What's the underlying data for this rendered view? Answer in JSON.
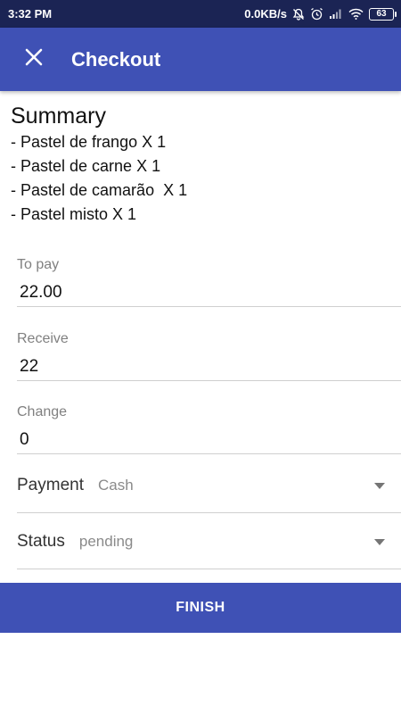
{
  "status_bar": {
    "time": "3:32 PM",
    "network_speed": "0.0KB/s",
    "battery_level": "63",
    "icons": [
      "mute-notification-icon",
      "alarm-icon",
      "signal-icon",
      "wifi-icon",
      "battery-icon"
    ]
  },
  "app_bar": {
    "title": "Checkout",
    "close_icon": "close-icon",
    "color": "#3f51b5"
  },
  "summary": {
    "title": "Summary",
    "items": [
      "- Pastel de frango X 1",
      "- Pastel de carne X 1",
      "- Pastel de camarão  X 1",
      "- Pastel misto X 1"
    ]
  },
  "form": {
    "to_pay": {
      "label": "To pay",
      "value": "22.00"
    },
    "receive": {
      "label": "Receive",
      "value": "22"
    },
    "change": {
      "label": "Change",
      "value": "0"
    },
    "payment": {
      "label": "Payment",
      "value": "Cash"
    },
    "status": {
      "label": "Status",
      "value": "pending"
    }
  },
  "finish_button": {
    "label": "FINISH"
  }
}
